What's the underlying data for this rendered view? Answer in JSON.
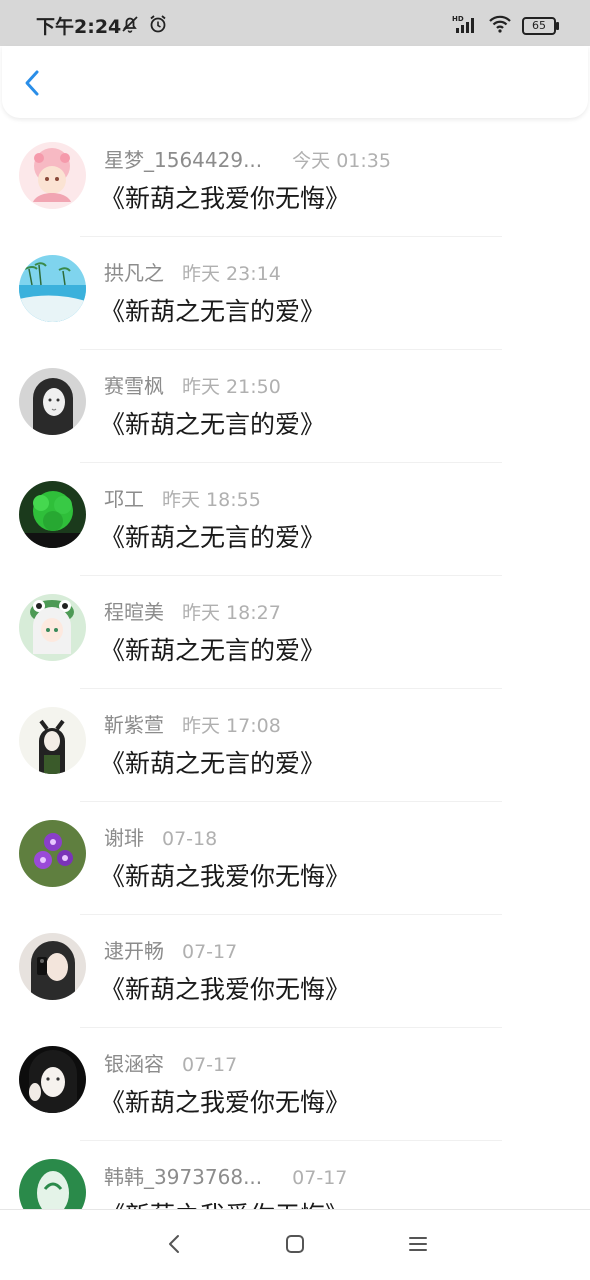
{
  "status_bar": {
    "time": "下午2:24",
    "icons_left": [
      "mute-bell-icon",
      "alarm-icon"
    ],
    "icons_right": [
      "hd-signal-icon",
      "wifi-icon"
    ],
    "battery": "65"
  },
  "header": {
    "back_icon": "chevron-left-icon",
    "accent": "#2a8ee8"
  },
  "list": {
    "items": [
      {
        "name": "星梦_1564429...",
        "time": "今天 01:35",
        "title": "《新葫之我爱你无悔》"
      },
      {
        "name": "拱凡之",
        "time": "昨天 23:14",
        "title": "《新葫之无言的爱》"
      },
      {
        "name": "赛雪枫",
        "time": "昨天 21:50",
        "title": "《新葫之无言的爱》"
      },
      {
        "name": "邛工",
        "time": "昨天 18:55",
        "title": "《新葫之无言的爱》"
      },
      {
        "name": "程暄美",
        "time": "昨天 18:27",
        "title": "《新葫之无言的爱》"
      },
      {
        "name": "靳紫萱",
        "time": "昨天 17:08",
        "title": "《新葫之无言的爱》"
      },
      {
        "name": "谢琲",
        "time": "07-18",
        "title": "《新葫之我爱你无悔》"
      },
      {
        "name": "逮开畅",
        "time": "07-17",
        "title": "《新葫之我爱你无悔》"
      },
      {
        "name": "银涵容",
        "time": "07-17",
        "title": "《新葫之我爱你无悔》"
      },
      {
        "name": "韩韩_3973768...",
        "time": "07-17",
        "title": "《新葫之我爱你无悔》"
      }
    ]
  },
  "nav_bar": {
    "icons": [
      "back-nav-icon",
      "home-nav-icon",
      "menu-nav-icon"
    ]
  }
}
